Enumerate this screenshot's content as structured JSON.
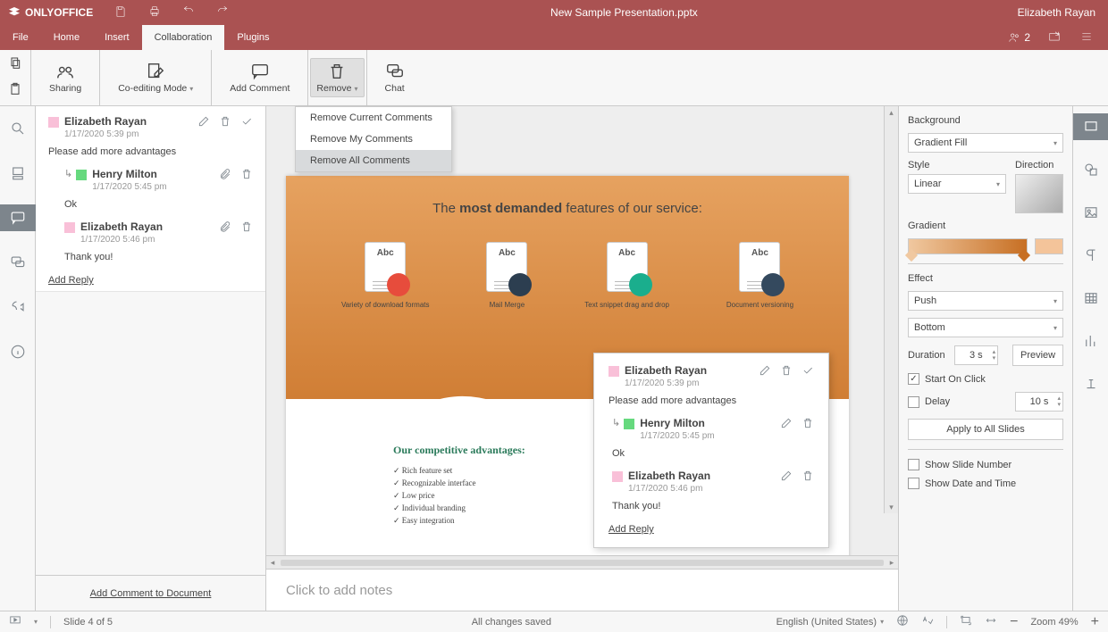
{
  "app": {
    "name": "ONLYOFFICE",
    "title": "New Sample Presentation.pptx",
    "user": "Elizabeth Rayan"
  },
  "menu": {
    "file": "File",
    "home": "Home",
    "insert": "Insert",
    "collaboration": "Collaboration",
    "plugins": "Plugins",
    "users_count": "2"
  },
  "ribbon": {
    "sharing": "Sharing",
    "coediting": "Co-editing Mode",
    "add_comment": "Add Comment",
    "remove": "Remove",
    "chat": "Chat",
    "remove_menu": [
      "Remove Current Comments",
      "Remove My Comments",
      "Remove All Comments"
    ]
  },
  "comments": {
    "thread": {
      "author": "Elizabeth Rayan",
      "date": "1/17/2020 5:39 pm",
      "text": "Please add more advantages",
      "replies": [
        {
          "author": "Henry Milton",
          "date": "1/17/2020 5:45 pm",
          "text": "Ok",
          "color": "green"
        },
        {
          "author": "Elizabeth Rayan",
          "date": "1/17/2020 5:46 pm",
          "text": "Thank you!",
          "color": "pink"
        }
      ],
      "add_reply": "Add Reply"
    },
    "footer": "Add Comment to Document"
  },
  "slide": {
    "title_pre": "The ",
    "title_bold": "most demanded",
    "title_post": " features of our service:",
    "features": [
      "Variety of download formats",
      "Mail Merge",
      "Text snippet drag and drop",
      "Document versioning"
    ],
    "adv_title": "Our competitive advantages:",
    "adv_items": [
      "Rich feature set",
      "Recognizable interface",
      "Low price",
      "Individual branding",
      "Easy integration"
    ],
    "notes_placeholder": "Click to add notes"
  },
  "floating": {
    "author": "Elizabeth Rayan",
    "date": "1/17/2020 5:39 pm",
    "text": "Please add more advantages",
    "replies": [
      {
        "author": "Henry Milton",
        "date": "1/17/2020 5:45 pm",
        "text": "Ok",
        "color": "green"
      },
      {
        "author": "Elizabeth Rayan",
        "date": "1/17/2020 5:46 pm",
        "text": "Thank you!",
        "color": "pink"
      }
    ],
    "add_reply": "Add Reply"
  },
  "right": {
    "background": "Background",
    "fill": "Gradient Fill",
    "style": "Style",
    "style_v": "Linear",
    "direction": "Direction",
    "gradient": "Gradient",
    "effect": "Effect",
    "effect_v": "Push",
    "effect_dir": "Bottom",
    "duration": "Duration",
    "duration_v": "3 s",
    "preview": "Preview",
    "start_on_click": "Start On Click",
    "delay": "Delay",
    "delay_v": "10 s",
    "apply_all": "Apply to All Slides",
    "show_slide_number": "Show Slide Number",
    "show_date": "Show Date and Time"
  },
  "status": {
    "slide": "Slide 4 of 5",
    "saved": "All changes saved",
    "lang": "English (United States)",
    "zoom": "Zoom 49%"
  }
}
